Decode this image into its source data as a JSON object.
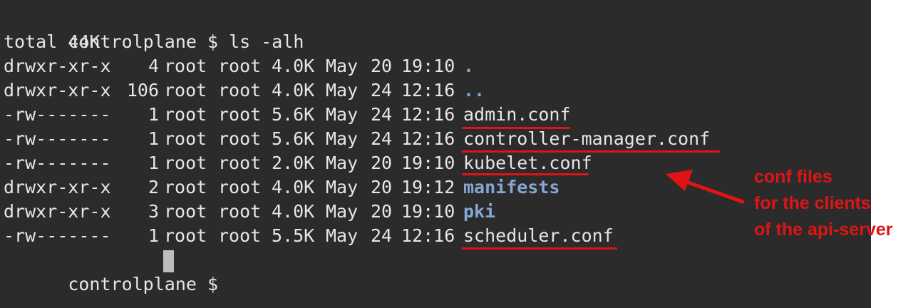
{
  "terminal": {
    "prompt": "controlplane $",
    "command": "ls -alh",
    "total_line": "total 44K",
    "entries": [
      {
        "perms": "drwxr-xr-x",
        "links": "4",
        "owner": "root",
        "group": "root",
        "size": "4.0K",
        "month": "May",
        "day": "20",
        "time": "19:10",
        "name": "."
      },
      {
        "perms": "drwxr-xr-x",
        "links": "106",
        "owner": "root",
        "group": "root",
        "size": "4.0K",
        "month": "May",
        "day": "24",
        "time": "12:16",
        "name": ".."
      },
      {
        "perms": "-rw-------",
        "links": "1",
        "owner": "root",
        "group": "root",
        "size": "5.6K",
        "month": "May",
        "day": "24",
        "time": "12:16",
        "name": "admin.conf"
      },
      {
        "perms": "-rw-------",
        "links": "1",
        "owner": "root",
        "group": "root",
        "size": "5.6K",
        "month": "May",
        "day": "24",
        "time": "12:16",
        "name": "controller-manager.conf"
      },
      {
        "perms": "-rw-------",
        "links": "1",
        "owner": "root",
        "group": "root",
        "size": "2.0K",
        "month": "May",
        "day": "20",
        "time": "19:10",
        "name": "kubelet.conf"
      },
      {
        "perms": "drwxr-xr-x",
        "links": "2",
        "owner": "root",
        "group": "root",
        "size": "4.0K",
        "month": "May",
        "day": "20",
        "time": "19:12",
        "name": "manifests"
      },
      {
        "perms": "drwxr-xr-x",
        "links": "3",
        "owner": "root",
        "group": "root",
        "size": "4.0K",
        "month": "May",
        "day": "20",
        "time": "19:10",
        "name": "pki"
      },
      {
        "perms": "-rw-------",
        "links": "1",
        "owner": "root",
        "group": "root",
        "size": "5.5K",
        "month": "May",
        "day": "24",
        "time": "12:16",
        "name": "scheduler.conf"
      }
    ],
    "final_prompt": "controlplane $"
  },
  "annotation": {
    "lines": [
      "conf files",
      "for the clients",
      "of the api-server"
    ]
  },
  "colors": {
    "terminal_bg": "#2b2b2b",
    "text": "#e6e6e6",
    "directory": "#86a7d4",
    "annotation_red": "#e01414"
  }
}
